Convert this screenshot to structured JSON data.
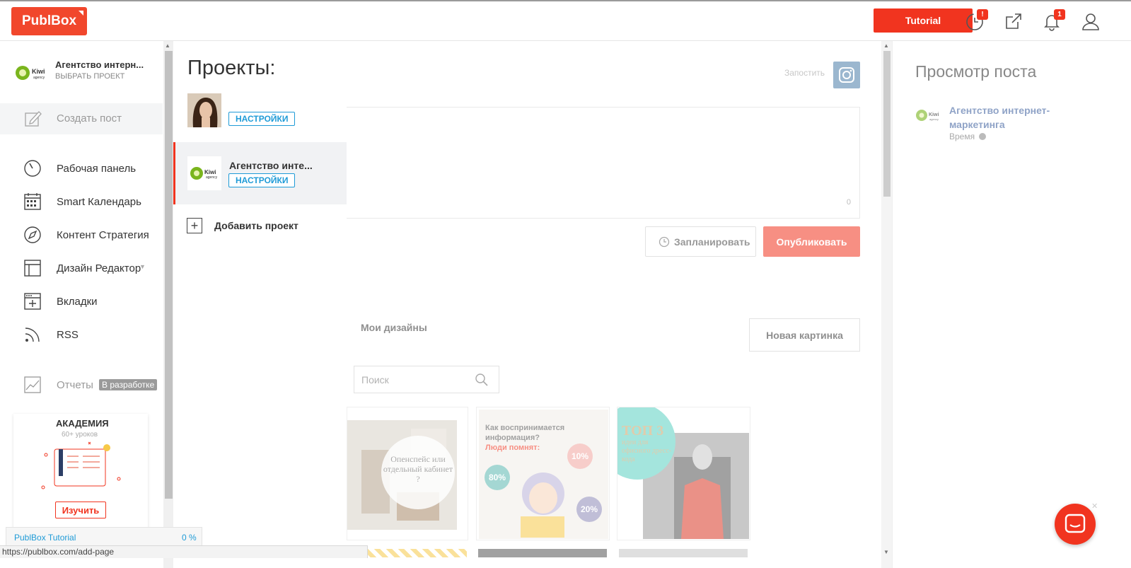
{
  "header": {
    "logo_text": "PublBox",
    "tutorial_label": "Tutorial",
    "history_badge": "!",
    "notifications_badge": "1"
  },
  "sidebar": {
    "project_name": "Агентство интерн...",
    "project_sub": "ВЫБРАТЬ ПРОЕКТ",
    "create_post": "Создать пост",
    "items": [
      {
        "label": "Рабочая панель",
        "icon": "dashboard-icon"
      },
      {
        "label": "Smart Календарь",
        "icon": "calendar-icon"
      },
      {
        "label": "Контент Стратегия",
        "icon": "compass-icon"
      },
      {
        "label": "Дизайн Редактор",
        "icon": "layout-icon"
      },
      {
        "label": "Вкладки",
        "icon": "tabs-icon"
      },
      {
        "label": "RSS",
        "icon": "rss-icon"
      }
    ],
    "reports_label": "Отчеты",
    "reports_badge": "В разработке",
    "academy": {
      "title": "АКАДЕМИЯ",
      "subtitle": "60+ уроков",
      "button": "Изучить"
    }
  },
  "projects_panel": {
    "title": "Проекты:",
    "settings_label": "НАСТРОЙКИ",
    "project2_name": "Агентство инте...",
    "add_project": "Добавить проект"
  },
  "composer": {
    "post_now_label": "Запостить",
    "char_count": "0",
    "schedule_label": "Запланировать",
    "publish_label": "Опубликовать"
  },
  "designs": {
    "tab_label": "Мои дизайны",
    "new_image_label": "Новая картинка",
    "search_placeholder": "Поиск",
    "card1_text": "Опенспейс или отдельный кабинет ?",
    "card2_title": "Как воспринимается информация?",
    "card2_sub": "Люди помнят:",
    "card2_p1": "10%",
    "card2_p2": "80%",
    "card2_p3": "20%",
    "card3_title": "ТОП 3",
    "card3_sub": "идеи для офисного дресс-кода"
  },
  "preview": {
    "title": "Просмотр поста",
    "account_name": "Агентство интернет-маркетинга",
    "time_label": "Время"
  },
  "footer": {
    "tutorial_bar_label": "PublBox Tutorial",
    "tutorial_progress": "0 %",
    "status_url": "https://publbox.com/add-page"
  },
  "colors": {
    "brand": "#f1341f",
    "link_blue": "#1f9bd7"
  }
}
